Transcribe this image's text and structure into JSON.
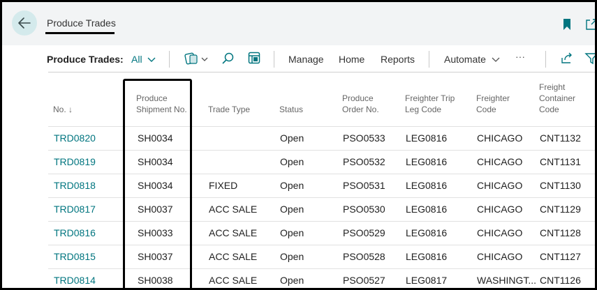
{
  "header": {
    "title": "Produce Trades",
    "back_icon": "arrow-left-icon",
    "bookmark_icon": "bookmark-icon",
    "popout_icon": "open-in-new-icon"
  },
  "actionbar": {
    "page_label": "Produce Trades:",
    "filter_label": "All",
    "manage": "Manage",
    "home": "Home",
    "reports": "Reports",
    "automate": "Automate",
    "more": "···"
  },
  "columns": {
    "no": "No.",
    "sort_arrow": "↓",
    "shipment_1": "Produce",
    "shipment_2": "Shipment No.",
    "trade_type": "Trade Type",
    "status": "Status",
    "order_1": "Produce",
    "order_2": "Order No.",
    "leg_1": "Freighter Trip",
    "leg_2": "Leg Code",
    "freighter_1": "Freighter",
    "freighter_2": "Code",
    "container_1": "Freight",
    "container_2": "Container",
    "container_3": "Code"
  },
  "rows": [
    {
      "no": "TRD0820",
      "shipment": "SH0034",
      "trade_type": "",
      "status": "Open",
      "order": "PSO0533",
      "leg": "LEG0816",
      "freighter": "CHICAGO",
      "container": "CNT1132"
    },
    {
      "no": "TRD0819",
      "shipment": "SH0034",
      "trade_type": "",
      "status": "Open",
      "order": "PSO0532",
      "leg": "LEG0816",
      "freighter": "CHICAGO",
      "container": "CNT1131"
    },
    {
      "no": "TRD0818",
      "shipment": "SH0034",
      "trade_type": "FIXED",
      "status": "Open",
      "order": "PSO0531",
      "leg": "LEG0816",
      "freighter": "CHICAGO",
      "container": "CNT1130"
    },
    {
      "no": "TRD0817",
      "shipment": "SH0037",
      "trade_type": "ACC SALE",
      "status": "Open",
      "order": "PSO0530",
      "leg": "LEG0816",
      "freighter": "CHICAGO",
      "container": "CNT1129"
    },
    {
      "no": "TRD0816",
      "shipment": "SH0033",
      "trade_type": "ACC SALE",
      "status": "Open",
      "order": "PSO0529",
      "leg": "LEG0816",
      "freighter": "CHICAGO",
      "container": "CNT1128"
    },
    {
      "no": "TRD0815",
      "shipment": "SH0037",
      "trade_type": "ACC SALE",
      "status": "Open",
      "order": "PSO0528",
      "leg": "LEG0816",
      "freighter": "CHICAGO",
      "container": "CNT1127"
    },
    {
      "no": "TRD0814",
      "shipment": "SH0038",
      "trade_type": "ACC SALE",
      "status": "Open",
      "order": "PSO0527",
      "leg": "LEG0817",
      "freighter": "WASHINGT...",
      "container": "CNT1126"
    }
  ],
  "colors": {
    "accent": "#00757f",
    "topbar_bg": "#f2f4f5",
    "back_button_bg": "#d4eaec"
  }
}
